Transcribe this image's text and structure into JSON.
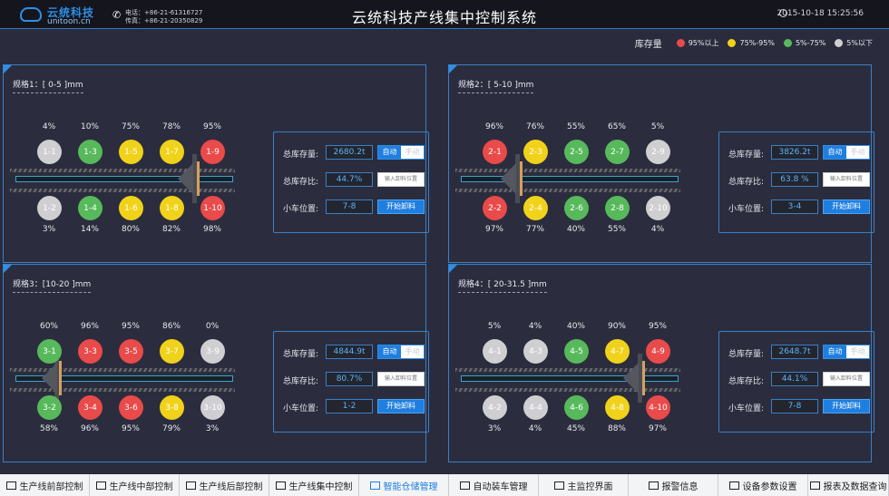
{
  "header": {
    "logo_cn": "云统科技",
    "logo_en": "unitoon.cn",
    "phone": "电话：+86-21-61316727",
    "fax": "传真：+86-21-20350829",
    "title": "云统科技产线集中控制系统",
    "datetime": "2015-10-18  15:25:56"
  },
  "legend": {
    "title": "库存量",
    "items": [
      {
        "label": "95%以上",
        "color": "#e94a4a"
      },
      {
        "label": "75%-95%",
        "color": "#f1d21a"
      },
      {
        "label": "5%-75%",
        "color": "#57b95b"
      },
      {
        "label": "5%以下",
        "color": "#cfcfd2"
      }
    ]
  },
  "panels": [
    {
      "spec": "规格1：[ 0-5 ]mm",
      "top": [
        {
          "pct": "4%",
          "id": "1-1",
          "level": "gray"
        },
        {
          "pct": "10%",
          "id": "1-3",
          "level": "green"
        },
        {
          "pct": "75%",
          "id": "1-5",
          "level": "yellow"
        },
        {
          "pct": "78%",
          "id": "1-7",
          "level": "yellow"
        },
        {
          "pct": "95%",
          "id": "1-9",
          "level": "red"
        }
      ],
      "bottom": [
        {
          "pct": "3%",
          "id": "1-2",
          "level": "gray"
        },
        {
          "pct": "14%",
          "id": "1-4",
          "level": "green"
        },
        {
          "pct": "80%",
          "id": "1-6",
          "level": "yellow"
        },
        {
          "pct": "82%",
          "id": "1-8",
          "level": "yellow"
        },
        {
          "pct": "98%",
          "id": "1-10",
          "level": "red"
        }
      ],
      "car_slot": 4,
      "stock_label": "总库存量:",
      "stock": "2680.2t",
      "ratio_label": "总库存比:",
      "ratio": "44.7%",
      "pos_label": "小车位置:",
      "pos": "7-8",
      "auto": "自动",
      "manual": "手动",
      "input_placeholder": "输入卸料位置",
      "unload": "开始卸料"
    },
    {
      "spec": "规格2：[ 5-10 ]mm",
      "top": [
        {
          "pct": "96%",
          "id": "2-1",
          "level": "red"
        },
        {
          "pct": "76%",
          "id": "2-3",
          "level": "yellow"
        },
        {
          "pct": "55%",
          "id": "2-5",
          "level": "green"
        },
        {
          "pct": "65%",
          "id": "2-7",
          "level": "green"
        },
        {
          "pct": "5%",
          "id": "2-9",
          "level": "gray"
        }
      ],
      "bottom": [
        {
          "pct": "97%",
          "id": "2-2",
          "level": "red"
        },
        {
          "pct": "77%",
          "id": "2-4",
          "level": "yellow"
        },
        {
          "pct": "40%",
          "id": "2-6",
          "level": "green"
        },
        {
          "pct": "55%",
          "id": "2-8",
          "level": "green"
        },
        {
          "pct": "4%",
          "id": "2-10",
          "level": "gray"
        }
      ],
      "car_slot": 1,
      "stock_label": "总库存量:",
      "stock": "3826.2t",
      "ratio_label": "总库存比:",
      "ratio": "63.8 %",
      "pos_label": "小车位置:",
      "pos": "3-4",
      "auto": "自动",
      "manual": "手动",
      "input_placeholder": "输入卸料位置",
      "unload": "开始卸料"
    },
    {
      "spec": "规格3：[10-20 ]mm",
      "top": [
        {
          "pct": "60%",
          "id": "3-1",
          "level": "green"
        },
        {
          "pct": "96%",
          "id": "3-3",
          "level": "red"
        },
        {
          "pct": "95%",
          "id": "3-5",
          "level": "red"
        },
        {
          "pct": "86%",
          "id": "3-7",
          "level": "yellow"
        },
        {
          "pct": "0%",
          "id": "3-9",
          "level": "gray"
        }
      ],
      "bottom": [
        {
          "pct": "58%",
          "id": "3-2",
          "level": "green"
        },
        {
          "pct": "96%",
          "id": "3-4",
          "level": "red"
        },
        {
          "pct": "95%",
          "id": "3-6",
          "level": "red"
        },
        {
          "pct": "79%",
          "id": "3-8",
          "level": "yellow"
        },
        {
          "pct": "3%",
          "id": "3-10",
          "level": "gray"
        }
      ],
      "car_slot": 0,
      "stock_label": "总库存量:",
      "stock": "4844.9t",
      "ratio_label": "总库存比:",
      "ratio": "80.7%",
      "pos_label": "小车位置:",
      "pos": "1-2",
      "auto": "自动",
      "manual": "手动",
      "input_placeholder": "输入卸料位置",
      "unload": "开始卸料"
    },
    {
      "spec": "规格4：[ 20-31.5 ]mm",
      "top": [
        {
          "pct": "5%",
          "id": "4-1",
          "level": "gray"
        },
        {
          "pct": "4%",
          "id": "4-3",
          "level": "gray"
        },
        {
          "pct": "40%",
          "id": "4-5",
          "level": "green"
        },
        {
          "pct": "90%",
          "id": "4-7",
          "level": "yellow"
        },
        {
          "pct": "95%",
          "id": "4-9",
          "level": "red"
        }
      ],
      "bottom": [
        {
          "pct": "3%",
          "id": "4-2",
          "level": "gray"
        },
        {
          "pct": "4%",
          "id": "4-4",
          "level": "gray"
        },
        {
          "pct": "45%",
          "id": "4-6",
          "level": "green"
        },
        {
          "pct": "88%",
          "id": "4-8",
          "level": "yellow"
        },
        {
          "pct": "97%",
          "id": "4-10",
          "level": "red"
        }
      ],
      "car_slot": 4,
      "stock_label": "总库存量:",
      "stock": "2648.7t",
      "ratio_label": "总库存比:",
      "ratio": "44.1%",
      "pos_label": "小车位置:",
      "pos": "7-8",
      "auto": "自动",
      "manual": "手动",
      "input_placeholder": "输入卸料位置",
      "unload": "开始卸料"
    }
  ],
  "nav": [
    {
      "label": "生产线前部控制",
      "icon": "chart-icon"
    },
    {
      "label": "生产线中部控制",
      "icon": "chart-icon"
    },
    {
      "label": "生产线后部控制",
      "icon": "chart-icon"
    },
    {
      "label": "生产线集中控制",
      "icon": "chart-icon"
    },
    {
      "label": "智能仓储管理",
      "icon": "storage-icon",
      "active": true
    },
    {
      "label": "自动装车管理",
      "icon": "truck-icon"
    },
    {
      "label": "主监控界面",
      "icon": "bulb-icon"
    },
    {
      "label": "报警信息",
      "icon": "alert-icon"
    },
    {
      "label": "设备参数设置",
      "icon": "gear-icon"
    },
    {
      "label": "报表及数据查询",
      "icon": "report-icon"
    }
  ]
}
